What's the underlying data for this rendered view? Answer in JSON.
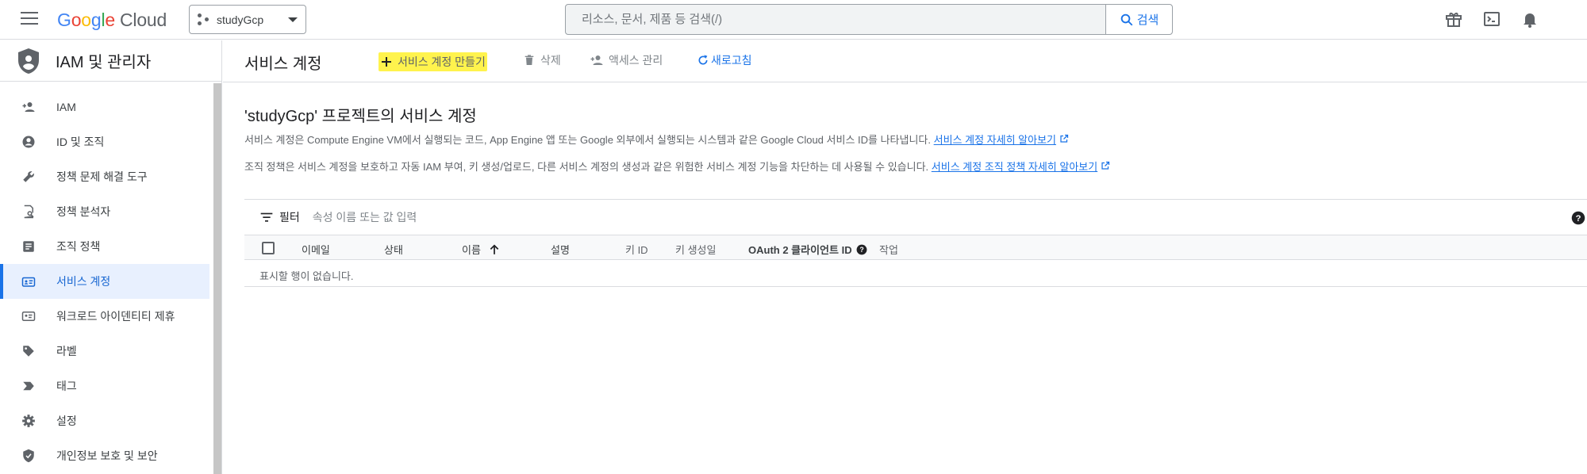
{
  "topbar": {
    "logo_google": "Google",
    "logo_cloud": "Cloud",
    "project_name": "studyGcp",
    "search_placeholder": "리소스, 문서, 제품 등 검색(/)",
    "search_button": "검색",
    "icons": [
      "menu-icon",
      "gift-icon",
      "terminal-icon",
      "bell-icon"
    ]
  },
  "sidebar": {
    "title": "IAM 및 관리자",
    "items": [
      {
        "label": "IAM",
        "icon": "person-add-icon"
      },
      {
        "label": "ID 및 조직",
        "icon": "account-circle-icon"
      },
      {
        "label": "정책 문제 해결 도구",
        "icon": "wrench-icon"
      },
      {
        "label": "정책 분석자",
        "icon": "policy-analyzer-icon"
      },
      {
        "label": "조직 정책",
        "icon": "article-icon"
      },
      {
        "label": "서비스 계정",
        "icon": "service-account-icon",
        "active": true
      },
      {
        "label": "워크로드 아이덴티티 제휴",
        "icon": "id-card-icon"
      },
      {
        "label": "라벨",
        "icon": "label-icon"
      },
      {
        "label": "태그",
        "icon": "tag-arrow-icon"
      },
      {
        "label": "설정",
        "icon": "gear-icon"
      },
      {
        "label": "개인정보 보호 및 보안",
        "icon": "shield-icon"
      }
    ]
  },
  "main": {
    "page_title": "서비스 계정",
    "toolbar": {
      "create": "서비스 계정 만들기",
      "delete": "삭제",
      "access": "액세스 관리",
      "refresh": "새로고침"
    },
    "section_title": "'studyGcp' 프로젝트의 서비스 계정",
    "desc1_text": "서비스 계정은 Compute Engine VM에서 실행되는 코드, App Engine 앱 또는 Google 외부에서 실행되는 시스템과 같은 Google Cloud 서비스 ID를 나타냅니다.",
    "desc1_link": "서비스 계정 자세히 알아보기",
    "desc2_text": "조직 정책은 서비스 계정을 보호하고 자동 IAM 부여, 키 생성/업로드, 다른 서비스 계정의 생성과 같은 위험한 서비스 계정 기능을 차단하는 데 사용될 수 있습니다.",
    "desc2_link": "서비스 계정 조직 정책 자세히 알아보기",
    "filter": {
      "label": "필터",
      "placeholder": "속성 이름 또는 값 입력"
    },
    "table": {
      "columns": [
        "이메일",
        "상태",
        "이름",
        "설명",
        "키 ID",
        "키 생성일",
        "OAuth 2 클라이언트 ID",
        "작업"
      ],
      "sorted_column": "이름",
      "empty_message": "표시할 행이 없습니다."
    }
  },
  "colors": {
    "accent": "#1a73e8",
    "highlight": "#fff34d",
    "active_bg": "#e8f0fe"
  }
}
